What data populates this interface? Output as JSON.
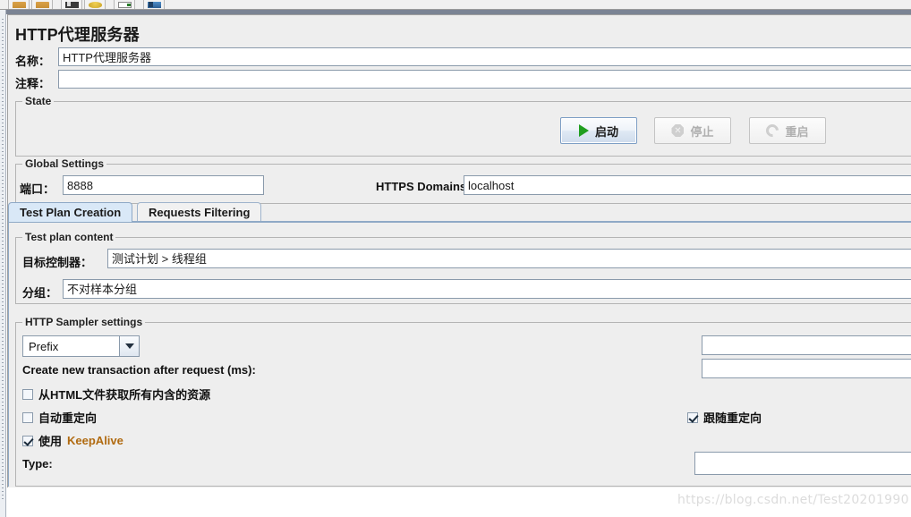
{
  "toolbar": {
    "buttons": [
      {
        "name": "open-folder-button",
        "icon": "folder-icon"
      },
      {
        "name": "save-folder-button",
        "icon": "folder-icon"
      },
      {
        "name": "templates-button",
        "icon": "disk-icon"
      },
      {
        "name": "shield-button",
        "icon": "shield-icon"
      },
      {
        "name": "start-no-pauses-button",
        "icon": "document-icon"
      },
      {
        "name": "remote-start-button",
        "icon": "blue-icon"
      }
    ]
  },
  "page": {
    "title": "HTTP代理服务器"
  },
  "name_row": {
    "label": "名称：",
    "value": "HTTP代理服务器"
  },
  "comment_row": {
    "label": "注释：",
    "value": ""
  },
  "state": {
    "legend": "State",
    "start_label": "启动",
    "stop_label": "停止",
    "restart_label": "重启"
  },
  "global_settings": {
    "legend": "Global Settings",
    "port_label": "端口：",
    "port_value": "8888",
    "https_domains_label": "HTTPS Domains:",
    "https_domains_value": "localhost"
  },
  "tabs": [
    {
      "label": "Test Plan Creation",
      "active": true
    },
    {
      "label": "Requests Filtering",
      "active": false
    }
  ],
  "test_plan_content": {
    "legend": "Test plan content",
    "target_controller_label": "目标控制器：",
    "target_controller_value": "测试计划 > 线程组",
    "grouping_label": "分组：",
    "grouping_value": "不对样本分组"
  },
  "http_sampler_settings": {
    "legend": "HTTP Sampler settings",
    "prefix_mode": "Prefix",
    "prefix_value": "",
    "transaction_label": "Create new transaction after request (ms):",
    "transaction_value": "",
    "retrieve_embedded_label": "从HTML文件获取所有内含的资源",
    "retrieve_embedded_checked": false,
    "auto_redirect_label": "自动重定向",
    "auto_redirect_checked": false,
    "follow_redirects_label": "跟随重定向",
    "follow_redirects_checked": true,
    "keepalive_label_prefix": "使用 ",
    "keepalive_label_keyword": "KeepAlive",
    "keepalive_checked": true,
    "type_label": "Type:",
    "type_value": ""
  },
  "watermark": {
    "text": "https://blog.csdn.net/Test20201990"
  },
  "colors": {
    "accent": "#d9e8f7",
    "panel": "#eeeeee",
    "field_border": "#8a9aab",
    "start_green": "#1f9e1f"
  }
}
